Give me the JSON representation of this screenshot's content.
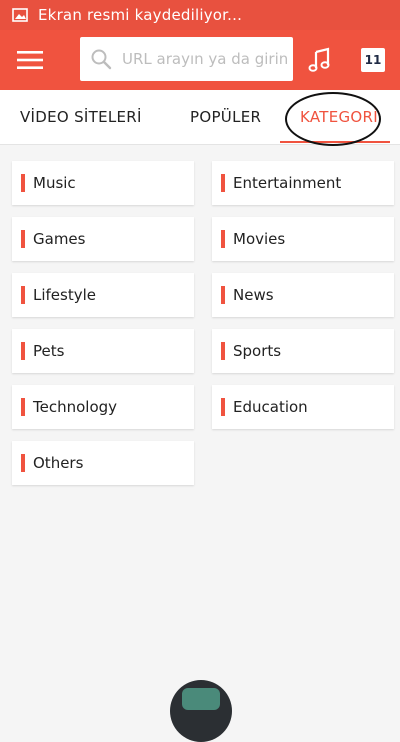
{
  "status_bar": {
    "text": "Ekran resmi kaydediliyor..."
  },
  "toolbar": {
    "search_placeholder": "URL arayın ya da girin",
    "tab_count": "11"
  },
  "tabs": [
    {
      "label": "VİDEO SİTELERİ"
    },
    {
      "label": "POPÜLER"
    },
    {
      "label": "KATEGORİ"
    }
  ],
  "categories": [
    {
      "label": "Music"
    },
    {
      "label": "Entertainment"
    },
    {
      "label": "Games"
    },
    {
      "label": "Movies"
    },
    {
      "label": "Lifestyle"
    },
    {
      "label": "News"
    },
    {
      "label": "Pets"
    },
    {
      "label": "Sports"
    },
    {
      "label": "Technology"
    },
    {
      "label": "Education"
    },
    {
      "label": "Others"
    }
  ],
  "colors": {
    "accent": "#f0533f",
    "status_bar": "#e8513f",
    "background": "#f5f5f5"
  }
}
